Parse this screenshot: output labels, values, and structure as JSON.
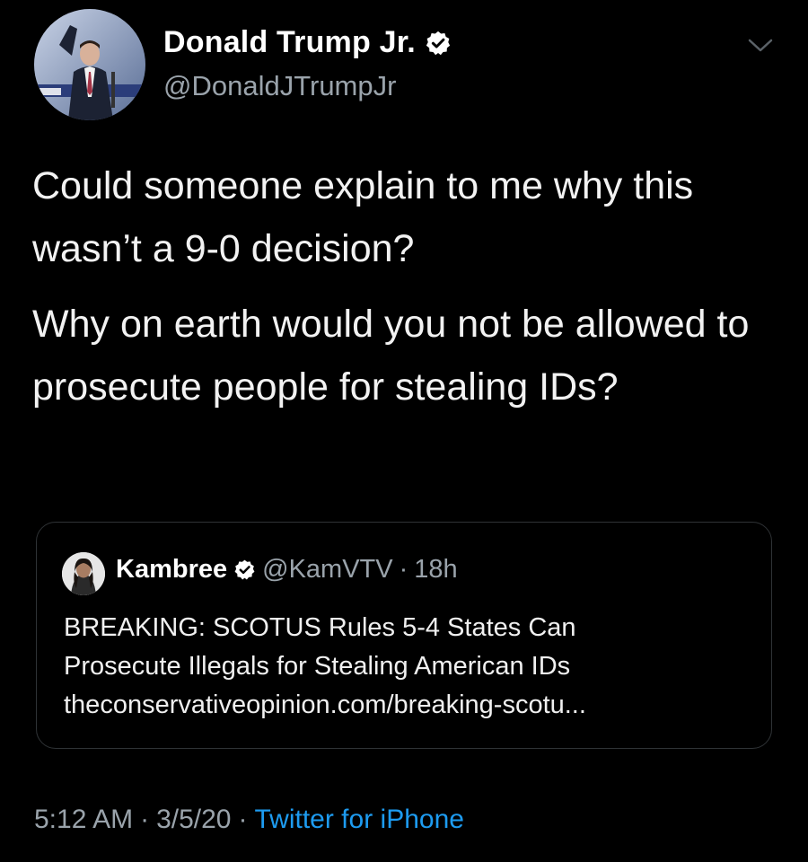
{
  "author": {
    "display_name": "Donald Trump Jr.",
    "handle": "@DonaldJTrumpJr",
    "verified_icon": "verified-badge-icon"
  },
  "tweet": {
    "paragraphs": [
      "Could someone explain to me why this wasn’t a 9-0 decision?",
      "Why on earth would you not be allowed to prosecute people for stealing IDs?"
    ]
  },
  "quoted_tweet": {
    "display_name": "Kambree",
    "handle": "@KamVTV",
    "separator": "·",
    "time": "18h",
    "text_lines": [
      "BREAKING: SCOTUS Rules 5-4 States Can",
      "Prosecute Illegals for Stealing American IDs",
      "theconservativeopinion.com/breaking-scotu..."
    ]
  },
  "footer": {
    "time": "5:12 AM",
    "separator1": "·",
    "date": "3/5/20",
    "separator2": "·",
    "source": "Twitter for iPhone"
  },
  "colors": {
    "background": "#000000",
    "text": "#f2f2f2",
    "secondary": "#9aa3ab",
    "link": "#1d9bf0",
    "border": "#2f3336"
  }
}
